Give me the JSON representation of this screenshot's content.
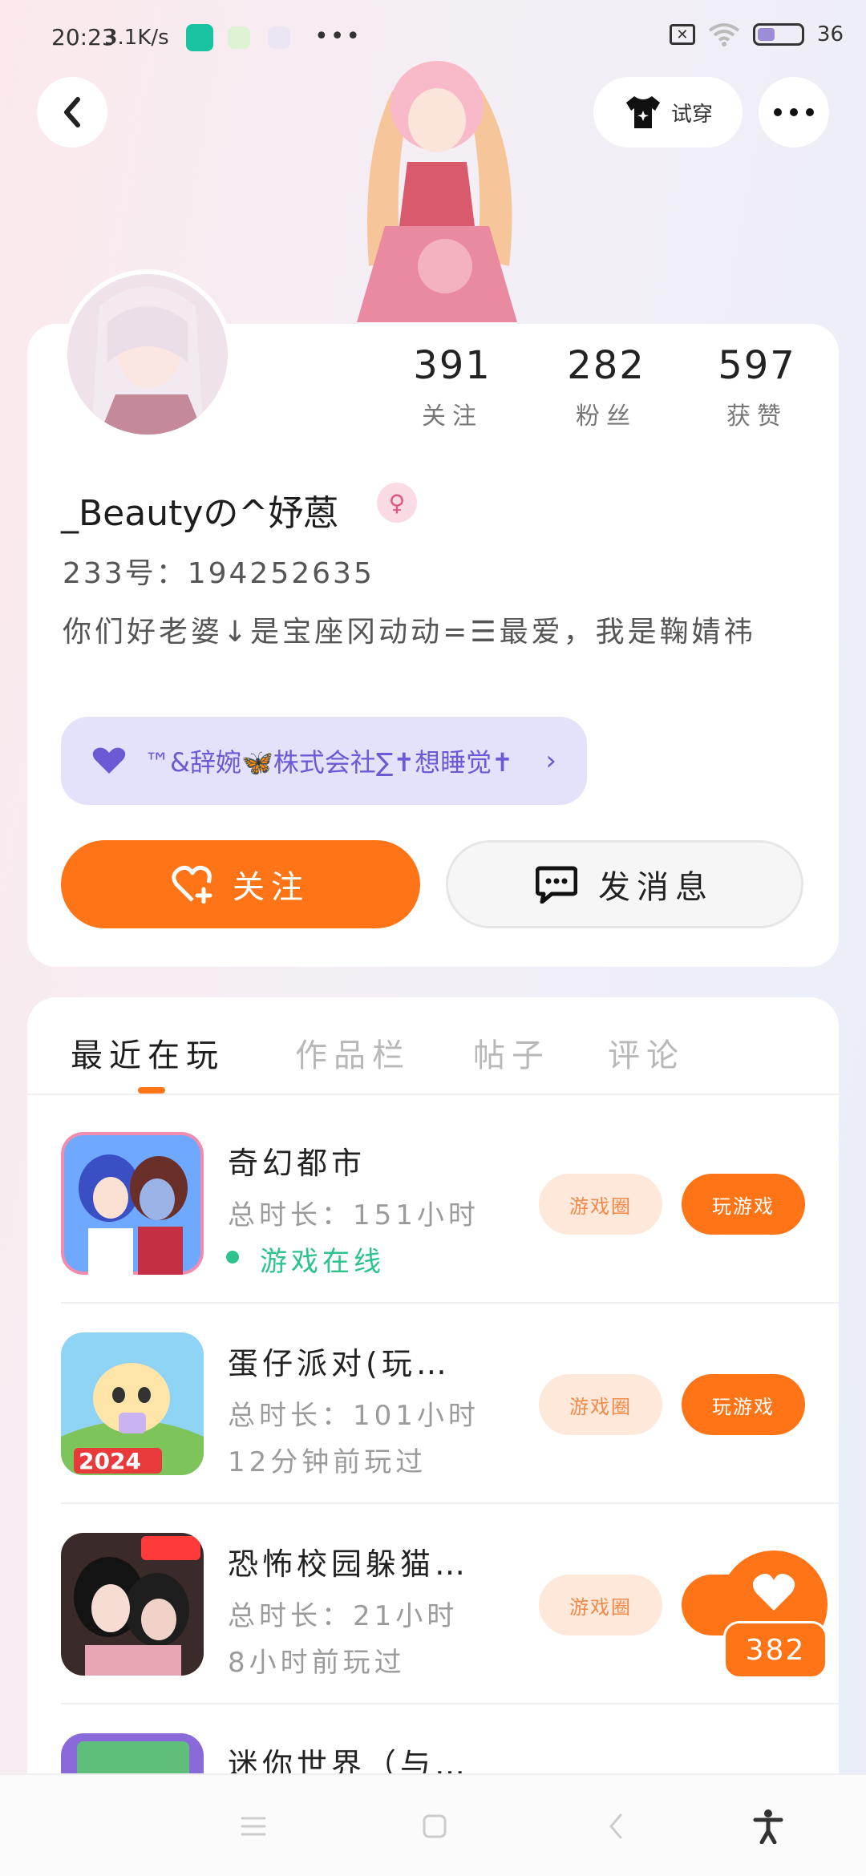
{
  "status_bar": {
    "time": "20:23",
    "speed": "3.1K/s",
    "more": "•••",
    "battery": "36"
  },
  "top_bar": {
    "try_on_label": "试穿"
  },
  "profile": {
    "stats": [
      {
        "value": "391",
        "label": "关注"
      },
      {
        "value": "282",
        "label": "粉丝"
      },
      {
        "value": "597",
        "label": "获赞"
      }
    ],
    "name": "_Beautyの^妤蒽",
    "uid": "233号：194252635",
    "bio": "你们好老婆↓是宝座冈动动=☰最爱，我是鞠婧祎",
    "tagline": "™&辞婉🦋株式会社∑✝想睡觉✝",
    "follow_label": "关注",
    "message_label": "发消息"
  },
  "tabs": [
    {
      "label": "最近在玩"
    },
    {
      "label": "作品栏"
    },
    {
      "label": "帖子"
    },
    {
      "label": "评论"
    }
  ],
  "games": [
    {
      "title": "奇幻都市",
      "meta": "总时长：151小时",
      "status": "游戏在线",
      "circle_label": "游戏圈",
      "play_label": "玩游戏"
    },
    {
      "title": "蛋仔派对(玩…",
      "meta": "总时长：101小时",
      "status": "12分钟前玩过",
      "circle_label": "游戏圈",
      "play_label": "玩游戏"
    },
    {
      "title": "恐怖校园躲猫…",
      "meta": "总时长：21小时",
      "status": "8小时前玩过",
      "circle_label": "游戏圈",
      "play_label": "玩"
    },
    {
      "title": "迷你世界（与…"
    }
  ],
  "like_fab": {
    "count": "382"
  },
  "colors": {
    "accent": "#ff7416",
    "online": "#2ec38c",
    "tag_bg": "#e4e1fb"
  }
}
